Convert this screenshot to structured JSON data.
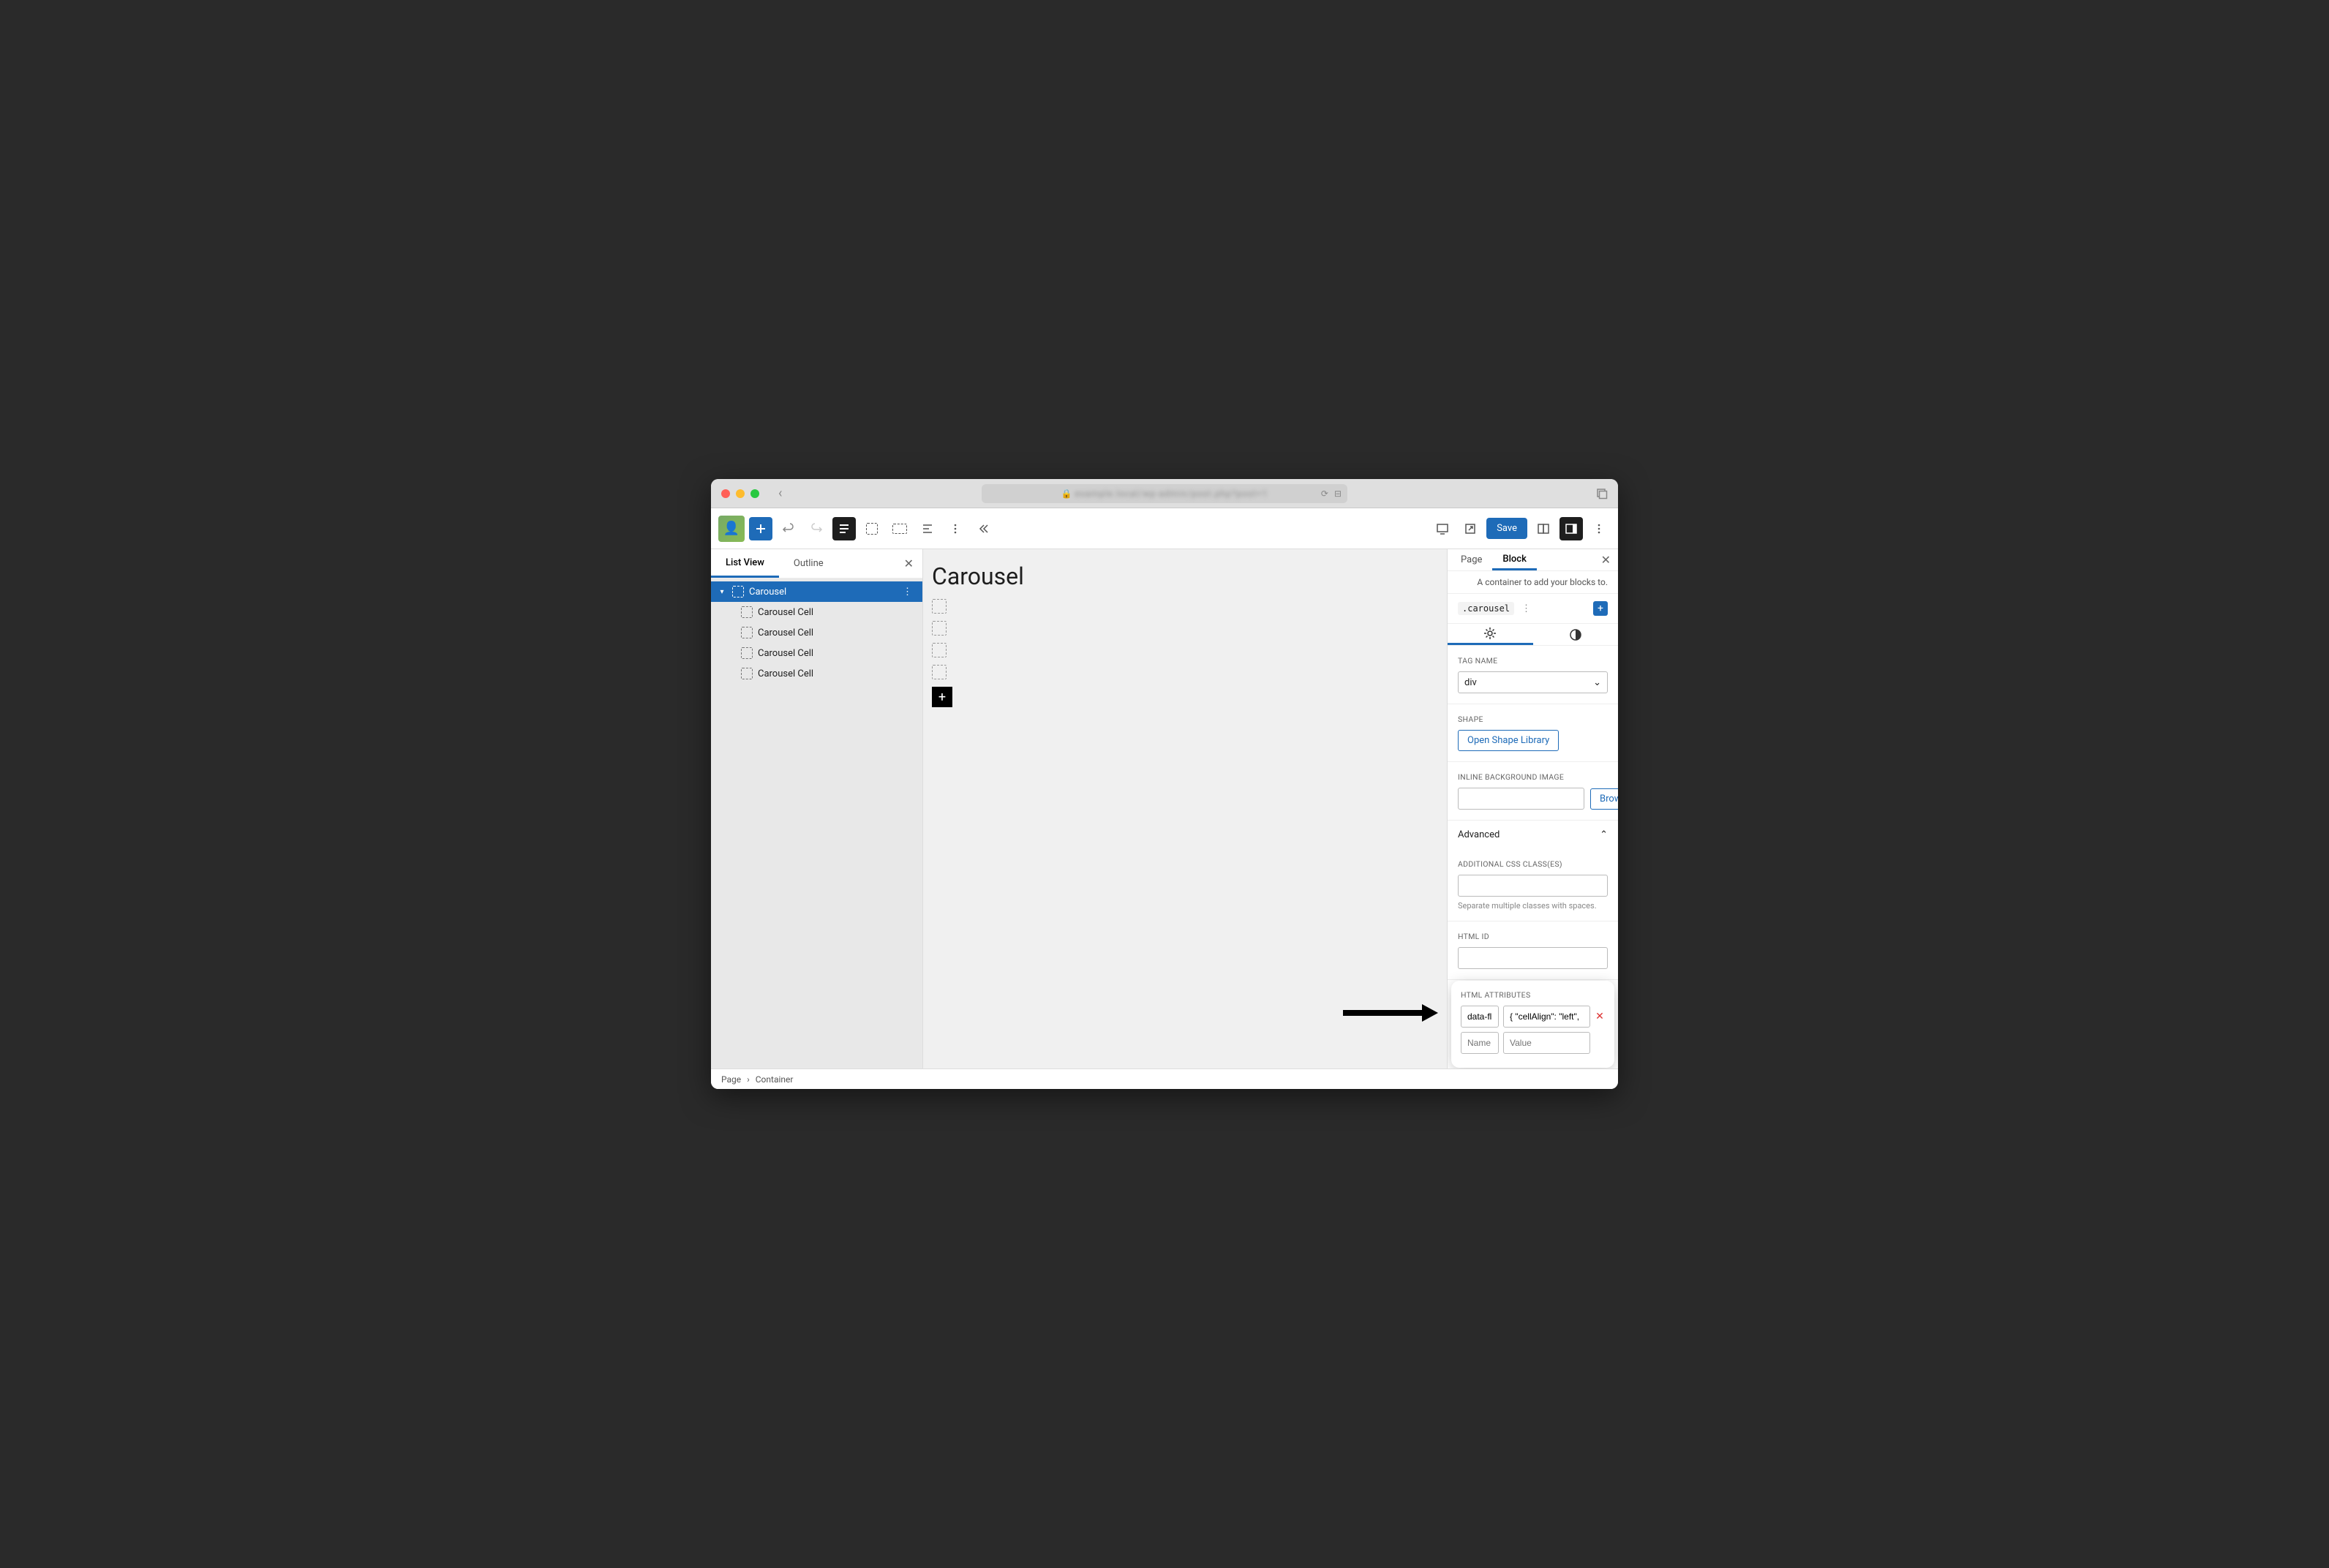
{
  "window": {
    "back": "‹"
  },
  "topbar": {
    "save": "Save"
  },
  "leftPanel": {
    "tabs": {
      "listView": "List View",
      "outline": "Outline"
    },
    "tree": {
      "root": "Carousel",
      "children": [
        "Carousel Cell",
        "Carousel Cell",
        "Carousel Cell",
        "Carousel Cell"
      ]
    }
  },
  "canvas": {
    "title": "Carousel"
  },
  "rightPanel": {
    "tabs": {
      "page": "Page",
      "block": "Block"
    },
    "description": "A container to add your blocks to.",
    "className": ".carousel",
    "tagName": {
      "label": "TAG NAME",
      "value": "div"
    },
    "shape": {
      "label": "SHAPE",
      "button": "Open Shape Library"
    },
    "bgImage": {
      "label": "INLINE BACKGROUND IMAGE",
      "browse": "Browse"
    },
    "advanced": {
      "title": "Advanced",
      "cssClass": {
        "label": "ADDITIONAL CSS CLASS(ES)",
        "help": "Separate multiple classes with spaces."
      },
      "htmlId": {
        "label": "HTML ID"
      },
      "attrs": {
        "label": "HTML ATTRIBUTES",
        "rows": [
          {
            "name": "data-flic",
            "value": "{ \"cellAlign\": \"left\","
          }
        ],
        "placeholderName": "Name",
        "placeholderValue": "Value"
      }
    }
  },
  "footer": {
    "crumbs": [
      "Page",
      "Container"
    ]
  }
}
